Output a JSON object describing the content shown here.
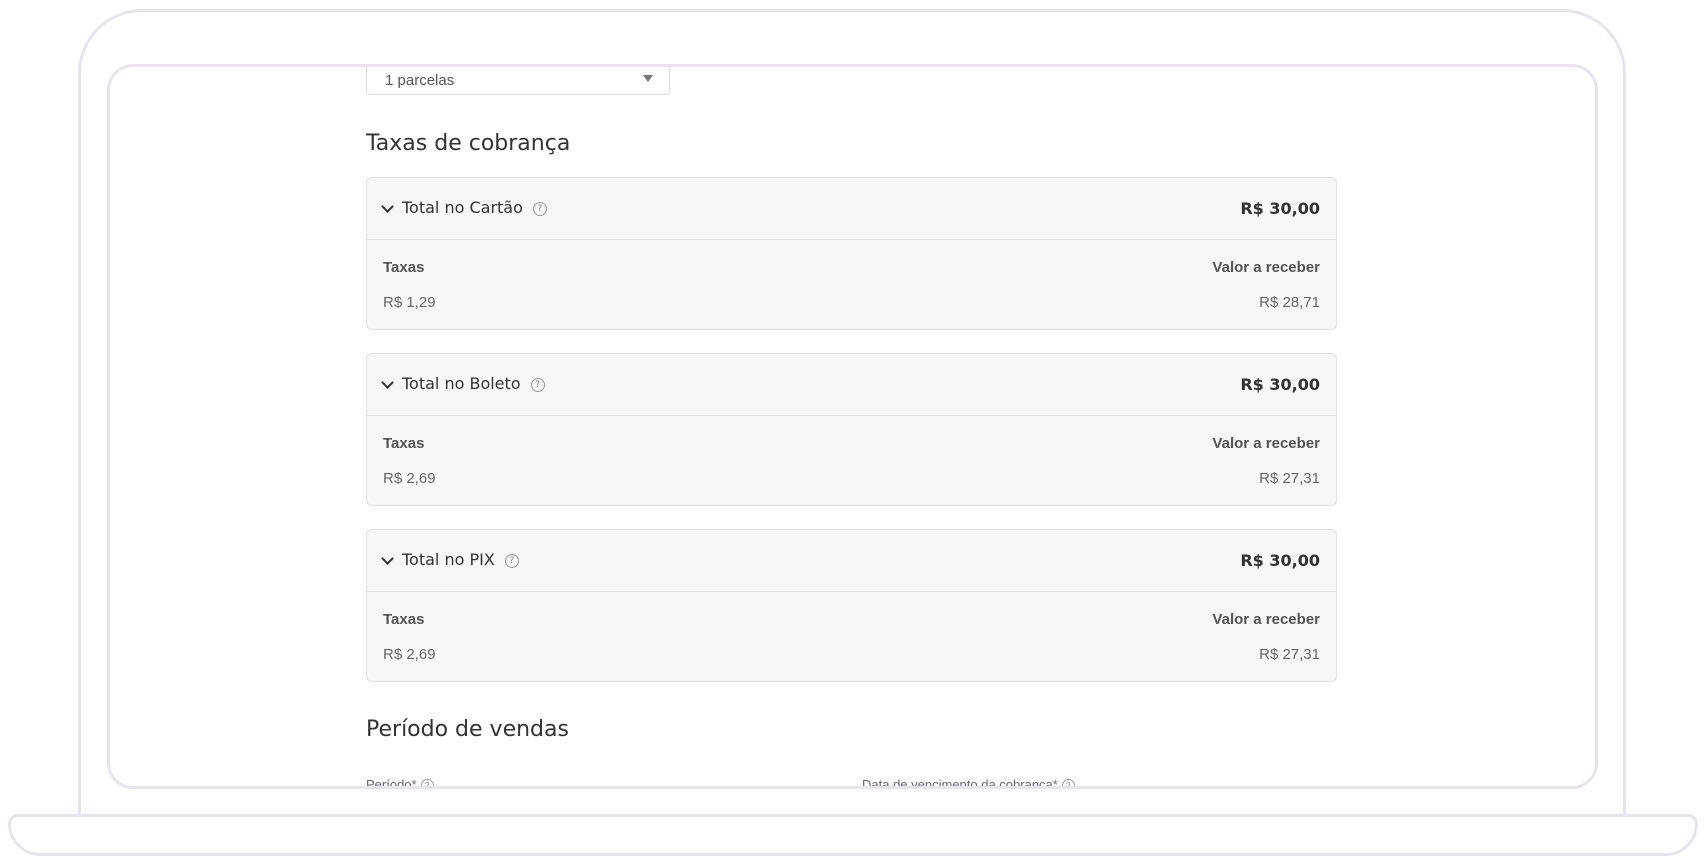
{
  "installments": {
    "selected": "1 parcelas"
  },
  "fees_section": {
    "title": "Taxas de cobrança"
  },
  "cards": [
    {
      "title": "Total no Cartão",
      "total": "R$ 30,00",
      "fees_label": "Taxas",
      "receive_label": "Valor a receber",
      "fees_value": "R$ 1,29",
      "receive_value": "R$ 28,71"
    },
    {
      "title": "Total no Boleto",
      "total": "R$ 30,00",
      "fees_label": "Taxas",
      "receive_label": "Valor a receber",
      "fees_value": "R$ 2,69",
      "receive_value": "R$ 27,31"
    },
    {
      "title": "Total no PIX",
      "total": "R$ 30,00",
      "fees_label": "Taxas",
      "receive_label": "Valor a receber",
      "fees_value": "R$ 2,69",
      "receive_value": "R$ 27,31"
    }
  ],
  "sales_period": {
    "title": "Período de vendas",
    "period_label": "Período*",
    "due_date_label": "Data de vencimento da cobrança*"
  },
  "icons": {
    "help": "?"
  }
}
